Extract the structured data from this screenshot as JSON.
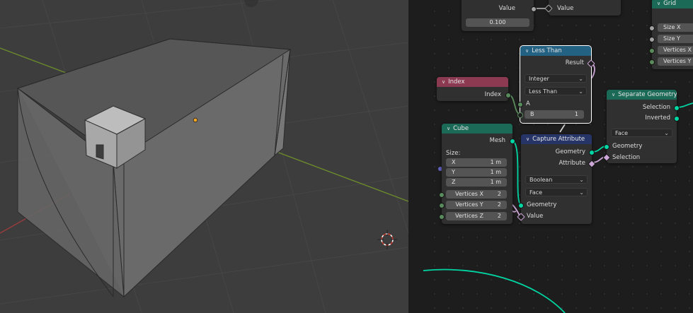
{
  "viewport": {
    "colors": {
      "background": "#3d3d3d",
      "x_axis": "#9b3c3c",
      "y_axis": "#6b8a2c",
      "mesh_face": "#6f6f6f",
      "cube": "#a5a5a5"
    },
    "icons": [
      "origin-dot-icon",
      "3d-cursor-icon"
    ]
  },
  "nodes": {
    "top": {
      "value_left": "Value",
      "value_right": "Value",
      "field": "0.100"
    },
    "grid": {
      "title": "Grid",
      "size_x": "Size X",
      "size_y": "Size Y",
      "vertices_x": "Vertices X",
      "vertices_y": "Vertices Y"
    },
    "less_than": {
      "title": "Less Than",
      "result": "Result",
      "data_type": "Integer",
      "operation": "Less Than",
      "a": "A",
      "b_label": "B",
      "b_value": "1"
    },
    "index": {
      "title": "Index",
      "output": "Index"
    },
    "separate_geometry": {
      "title": "Separate Geometry",
      "selection_out": "Selection",
      "inverted_out": "Inverted",
      "domain": "Face",
      "geometry_in": "Geometry",
      "selection_in": "Selection"
    },
    "cube": {
      "title": "Cube",
      "mesh": "Mesh",
      "size": "Size:",
      "x_label": "X",
      "x_value": "1 m",
      "y_label": "Y",
      "y_value": "1 m",
      "z_label": "Z",
      "z_value": "1 m",
      "vx_label": "Vertices X",
      "vx_value": "2",
      "vy_label": "Vertices Y",
      "vy_value": "2",
      "vz_label": "Vertices Z",
      "vz_value": "2"
    },
    "capture_attribute": {
      "title": "Capture Attribute",
      "geometry_out": "Geometry",
      "attribute_out": "Attribute",
      "data_type": "Boolean",
      "domain": "Face",
      "geometry_in": "Geometry",
      "value_in": "Value"
    }
  }
}
